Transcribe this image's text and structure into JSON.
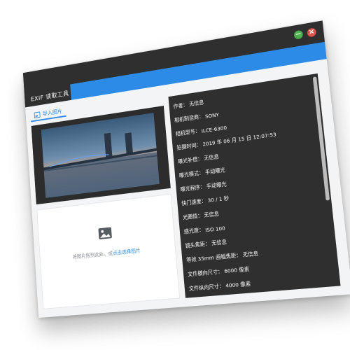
{
  "window": {
    "title": "EXIF 读取工具",
    "minimize_glyph": "−",
    "close_glyph": "×",
    "minimize_color": "#4cae4c",
    "close_color": "#e0534a"
  },
  "theme": {
    "accent": "#2b8be6",
    "titlebar": "#2f2f2f"
  },
  "tabs": [
    {
      "label": "导入图片",
      "icon": "image-icon"
    }
  ],
  "dropzone": {
    "text_before": "将图片拖到此处，或",
    "link": "点击选择图片",
    "icon": "image-placeholder-icon"
  },
  "preview": {
    "description_icon": "bridge-photo"
  },
  "exif": [
    {
      "key": "作者",
      "value": "无信息"
    },
    {
      "key": "相机制造商",
      "value": "SONY"
    },
    {
      "key": "相机型号",
      "value": "ILCE-6300"
    },
    {
      "key": "拍摄时间",
      "value": "2019 年 06 月 15 日 12:07:53"
    },
    {
      "key": "曝光补偿",
      "value": "无信息"
    },
    {
      "key": "曝光模式",
      "value": "手动曝光"
    },
    {
      "key": "曝光程序",
      "value": "手动曝光"
    },
    {
      "key": "快门速度",
      "value": "30 / 1 秒"
    },
    {
      "key": "光圈值",
      "value": "无信息"
    },
    {
      "key": "感光度",
      "value": "ISO 100"
    },
    {
      "key": "镜头焦距",
      "value": "无信息"
    },
    {
      "key": "等效 35mm 画幅焦距",
      "value": "无信息"
    },
    {
      "key": "文件横向尺寸",
      "value": "6000 像素"
    },
    {
      "key": "文件纵向尺寸",
      "value": "4000 像素"
    }
  ]
}
